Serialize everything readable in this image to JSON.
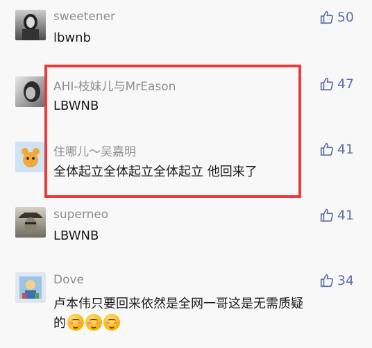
{
  "comments": [
    {
      "username": "sweetener",
      "text": "lbwnb",
      "likes": "50"
    },
    {
      "username": "AHI-枝妹儿与MrEason",
      "text": "LBWNB",
      "likes": "47"
    },
    {
      "username": "住哪儿～吴嘉明",
      "text": "全体起立全体起立全体起立  他回来了",
      "likes": "41"
    },
    {
      "username": "superneo",
      "text": "LBWNB",
      "likes": "41"
    },
    {
      "username": "Dove",
      "text": "卢本伟只要回来依然是全网一哥这是无需质疑",
      "text2": "的",
      "likes": "34"
    }
  ],
  "colors": {
    "highlight": "#ec3b3b",
    "like": "#5a6fa6"
  },
  "icons": {
    "like": "thumbs-up-icon",
    "emoji": "blush-emoji-icon"
  }
}
